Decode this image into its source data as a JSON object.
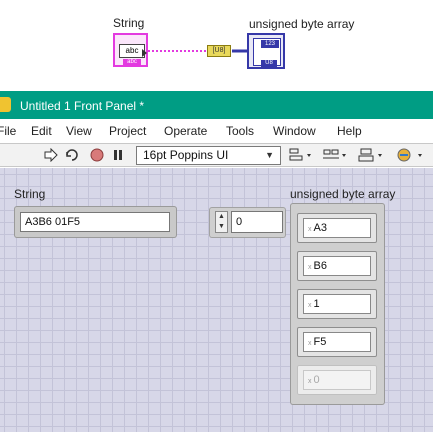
{
  "block_diagram": {
    "string_label": "String",
    "array_label": "unsigned byte array",
    "string_terminal_text": "abc",
    "string_terminal_tag": "abc",
    "conversion_text": "[U8]",
    "array_terminal_type": "123",
    "array_terminal_tag": "U8"
  },
  "window": {
    "title": "Untitled 1 Front Panel *"
  },
  "menu": [
    "File",
    "Edit",
    "View",
    "Project",
    "Operate",
    "Tools",
    "Window",
    "Help"
  ],
  "toolbar": {
    "font_select": "16pt Poppins UI"
  },
  "front_panel": {
    "string_label": "String",
    "string_value": "A3B6 01F5",
    "array_label": "unsigned byte array",
    "array_index": "0",
    "array_elements": [
      "A3",
      "B6",
      "1",
      "F5",
      "0"
    ]
  },
  "colors": {
    "titlebar": "#009d84",
    "string_wire": "#e33ae0",
    "array_wire": "#3538a8",
    "panel_grid": "#d7d7e8"
  }
}
